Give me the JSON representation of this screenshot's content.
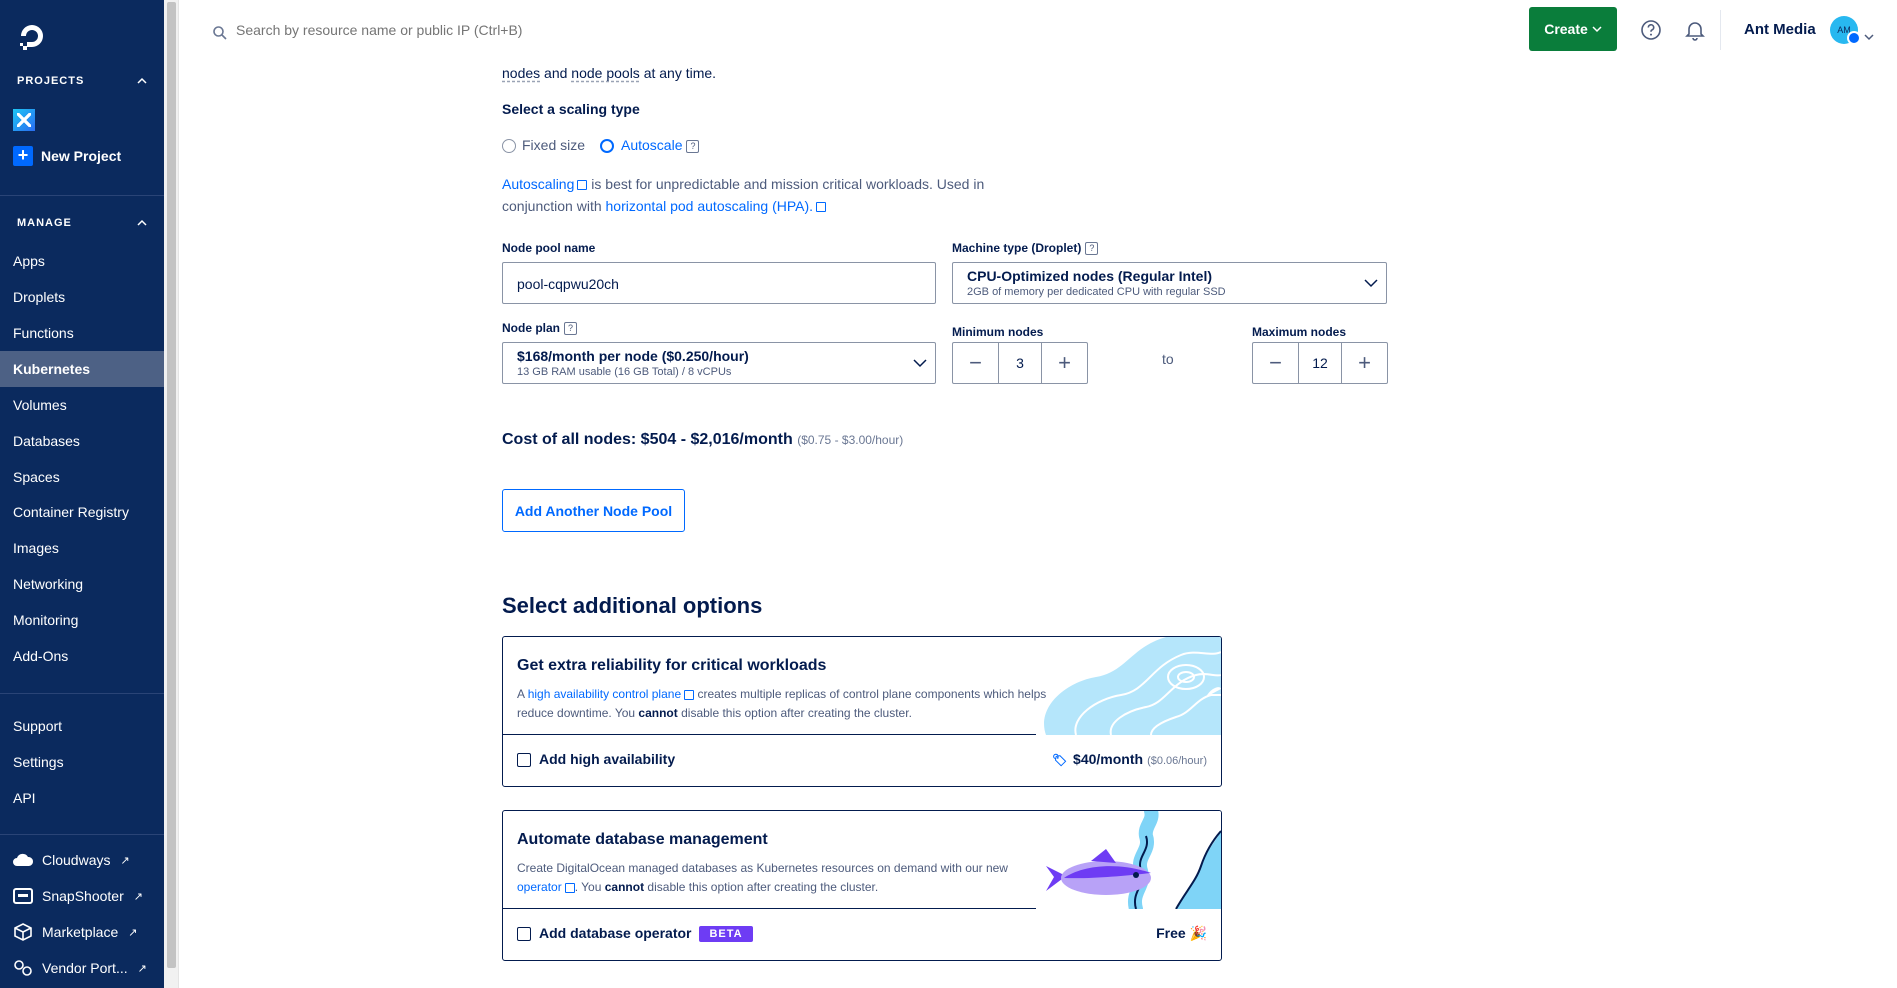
{
  "sidebar": {
    "projects_heading": "PROJECTS",
    "new_project": "New Project",
    "manage_heading": "MANAGE",
    "nav": [
      {
        "label": "Apps",
        "active": false
      },
      {
        "label": "Droplets",
        "active": false
      },
      {
        "label": "Functions",
        "active": false
      },
      {
        "label": "Kubernetes",
        "active": true
      },
      {
        "label": "Volumes",
        "active": false
      },
      {
        "label": "Databases",
        "active": false
      },
      {
        "label": "Spaces",
        "active": false
      },
      {
        "label": "Container Registry",
        "active": false
      },
      {
        "label": "Images",
        "active": false
      },
      {
        "label": "Networking",
        "active": false
      },
      {
        "label": "Monitoring",
        "active": false
      },
      {
        "label": "Add-Ons",
        "active": false
      }
    ],
    "support": [
      "Support",
      "Settings",
      "API"
    ],
    "external": [
      {
        "label": "Cloudways",
        "icon": "cloud-icon"
      },
      {
        "label": "SnapShooter",
        "icon": "snapshooter-icon"
      },
      {
        "label": "Marketplace",
        "icon": "cube-icon"
      },
      {
        "label": "Vendor Port...",
        "icon": "vendor-portal-icon"
      }
    ]
  },
  "topbar": {
    "search_placeholder": "Search by resource name or public IP (Ctrl+B)",
    "create_label": "Create",
    "team_name": "Ant Media",
    "avatar_initials": "AM"
  },
  "main": {
    "intro_link1": "nodes",
    "intro_and": "and",
    "intro_link2": "node pools",
    "intro_tail": "at any time.",
    "scaling_heading": "Select a scaling type",
    "scaling_options": [
      {
        "label": "Fixed size",
        "selected": false
      },
      {
        "label": "Autoscale",
        "selected": true
      }
    ],
    "autoscale_link": "Autoscaling",
    "autoscale_text1": " is best for unpredictable and mission critical workloads. Used in",
    "autoscale_text2": "conjunction with ",
    "hpa_link": "horizontal pod autoscaling (HPA).",
    "node_pool_name_label": "Node pool name",
    "node_pool_name_value": "pool-cqpwu20ch",
    "machine_type_label": "Machine type (Droplet)",
    "machine_type_value": "CPU-Optimized nodes (Regular Intel)",
    "machine_type_sub": "2GB of memory per dedicated CPU with regular SSD",
    "node_plan_label": "Node plan",
    "node_plan_value": "$168/month per node ($0.250/hour)",
    "node_plan_sub": "13 GB RAM usable (16 GB Total) / 8 vCPUs",
    "min_nodes_label": "Minimum nodes",
    "min_nodes_value": "3",
    "to_label": "to",
    "max_nodes_label": "Maximum nodes",
    "max_nodes_value": "12",
    "cost_label": "Cost of all nodes: $504 - $2,016/month",
    "cost_hourly": "($0.75 - $3.00/hour)",
    "add_pool_button": "Add Another Node Pool",
    "options_heading": "Select additional options",
    "ha_card": {
      "title": "Get extra reliability for critical workloads",
      "desc_prefix": "A ",
      "desc_link": "high availability control plane",
      "desc_mid": " creates multiple replicas of control plane components which helps reduce downtime. You ",
      "desc_bold": "cannot",
      "desc_tail": " disable this option after creating the cluster.",
      "checkbox_label": "Add high availability",
      "price": "$40/month",
      "price_hourly": "($0.06/hour)"
    },
    "db_card": {
      "title": "Automate database management",
      "desc_prefix": "Create DigitalOcean managed databases as Kubernetes resources on demand with our new ",
      "desc_link": "operator",
      "desc_mid": ". You ",
      "desc_bold": "cannot",
      "desc_tail": " disable this option after creating the cluster.",
      "checkbox_label": "Add database operator",
      "badge": "BETA",
      "price": "Free 🎉"
    }
  },
  "colors": {
    "sidebar_bg": "#0b2a5e",
    "primary": "#0069ff",
    "create_green": "#0a7d3b",
    "beta_purple": "#6e3cf4"
  }
}
